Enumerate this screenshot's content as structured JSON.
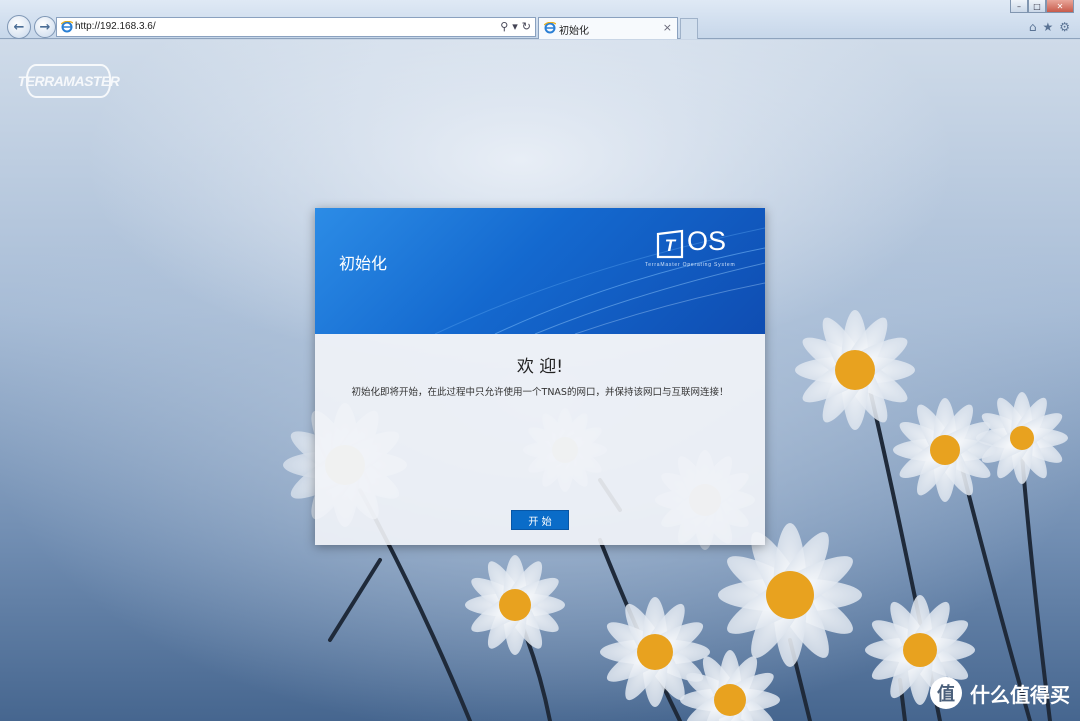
{
  "browser": {
    "url": "http://192.168.3.6/",
    "tab_title": "初始化",
    "tab_close": "×",
    "back_glyph": "←",
    "forward_glyph": "→",
    "addr_tools": [
      "⚲",
      "▾",
      "↻"
    ],
    "window_buttons": [
      "–",
      "□",
      "✕"
    ],
    "chrome_icons": [
      "⌂",
      "★",
      "⚙"
    ]
  },
  "page": {
    "brand_logo": "TERRAMASTER"
  },
  "dialog": {
    "header_title": "初始化",
    "os_logo_text": "OS",
    "os_logo_letter": "T",
    "os_subtitle": "TerraMaster Operating System",
    "welcome": "欢 迎!",
    "description": "初始化即将开始，在此过程中只允许使用一个TNAS的网口，并保持该网口与互联网连接！",
    "start_button": "开 始"
  },
  "watermark": {
    "icon": "值",
    "text": "什么值得买"
  },
  "colors": {
    "header_blue": "#1469cf",
    "button_blue": "#0a6cc8"
  }
}
